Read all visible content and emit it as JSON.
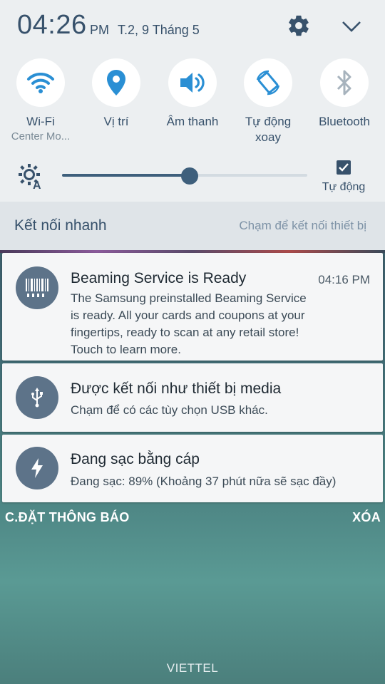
{
  "status": {
    "time": "04:26",
    "ampm": "PM",
    "date": "T.2, 9 Tháng 5"
  },
  "toggles": [
    {
      "label": "Wi-Fi",
      "sub": "Center Mo...",
      "icon": "wifi-icon"
    },
    {
      "label": "Vị trí",
      "sub": "",
      "icon": "location-icon"
    },
    {
      "label": "Âm thanh",
      "sub": "",
      "icon": "volume-icon"
    },
    {
      "label": "Tự động",
      "sub": "xoay",
      "icon": "auto-rotate-icon"
    },
    {
      "label": "Bluetooth",
      "sub": "",
      "icon": "bluetooth-icon"
    }
  ],
  "brightness": {
    "level": 0.52,
    "auto_label": "Tự động",
    "auto_checked": true
  },
  "quick_connect": {
    "title": "Kết nối nhanh",
    "hint": "Chạm để kết nối thiết bị"
  },
  "notifications": [
    {
      "icon": "barcode-icon",
      "title": "Beaming Service is Ready",
      "time": "04:16 PM",
      "body_lines": [
        "The Samsung preinstalled Beaming Service",
        "is ready. All your cards and coupons at your",
        "fingertips, ready to scan at any retail store!",
        "Touch to learn more."
      ]
    },
    {
      "icon": "usb-icon",
      "title": "Được kết nối như thiết bị media",
      "time": "",
      "body_lines": [
        "Chạm để có các tùy chọn USB khác."
      ]
    },
    {
      "icon": "charging-icon",
      "title": "Đang sạc bằng cáp",
      "time": "",
      "body_lines": [
        "Đang sạc: 89% (Khoảng 37 phút nữa sẽ sạc đầy)"
      ]
    }
  ],
  "actions": {
    "settings": "C.ĐẶT THÔNG BÁO",
    "clear": "XÓA"
  },
  "carrier": "VIETTEL",
  "colors": {
    "accent": "#3e5f7c",
    "icon_blue": "#2a8fd4",
    "avatar": "#5d7389"
  }
}
